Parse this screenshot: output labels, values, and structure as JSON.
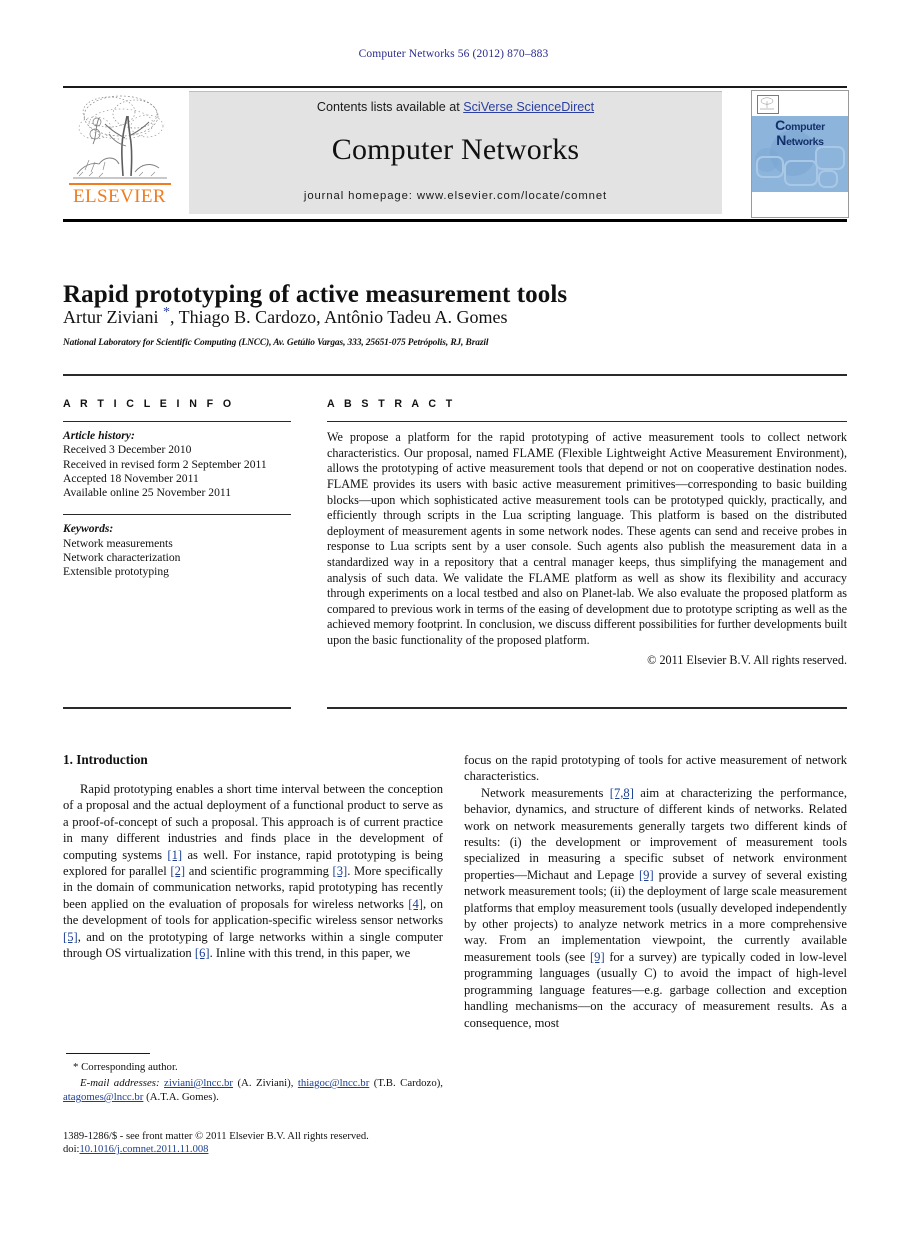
{
  "running_head": "Computer Networks 56 (2012) 870–883",
  "masthead": {
    "contents_prefix": "Contents lists available at ",
    "sciencedirect_link": "SciVerse ScienceDirect",
    "journal_title": "Computer Networks",
    "homepage": "journal homepage: www.elsevier.com/locate/comnet",
    "publisher_wordmark": "ELSEVIER",
    "cover_title_line1_big": "C",
    "cover_title_line1_rest": "omputer",
    "cover_title_line2_big": "N",
    "cover_title_line2_rest": "etworks"
  },
  "article": {
    "title": "Rapid prototyping of active measurement tools",
    "authors": "Artur Ziviani , Thiago B. Cardozo, Antônio Tadeu A. Gomes",
    "corresponding_marker": "*",
    "affiliation": "National Laboratory for Scientific Computing (LNCC), Av. Getúlio Vargas, 333, 25651-075 Petrópolis, RJ, Brazil"
  },
  "article_info": {
    "heading": "A R T I C L E   I N F O",
    "history_label": "Article history:",
    "history": [
      "Received 3 December 2010",
      "Received in revised form 2 September 2011",
      "Accepted 18 November 2011",
      "Available online 25 November 2011"
    ],
    "keywords_label": "Keywords:",
    "keywords": [
      "Network measurements",
      "Network characterization",
      "Extensible prototyping"
    ]
  },
  "abstract": {
    "heading": "A B S T R A C T",
    "text": "We propose a platform for the rapid prototyping of active measurement tools to collect network characteristics. Our proposal, named FLAME (Flexible Lightweight Active Measurement Environment), allows the prototyping of active measurement tools that depend or not on cooperative destination nodes. FLAME provides its users with basic active measurement primitives—corresponding to basic building blocks—upon which sophisticated active measurement tools can be prototyped quickly, practically, and efficiently through scripts in the Lua scripting language. This platform is based on the distributed deployment of measurement agents in some network nodes. These agents can send and receive probes in response to Lua scripts sent by a user console. Such agents also publish the measurement data in a standardized way in a repository that a central manager keeps, thus simplifying the management and analysis of such data. We validate the FLAME platform as well as show its flexibility and accuracy through experiments on a local testbed and also on Planet-lab. We also evaluate the proposed platform as compared to previous work in terms of the easing of development due to prototype scripting as well as the achieved memory footprint. In conclusion, we discuss different possibilities for further developments built upon the basic functionality of the proposed platform.",
    "copyright": "© 2011 Elsevier B.V. All rights reserved."
  },
  "body": {
    "section1_heading": "1. Introduction",
    "left_para1_a": "Rapid prototyping enables a short time interval between the conception of a proposal and the actual deployment of a functional product to serve as a proof-of-concept of such a proposal. This approach is of current practice in many different industries and finds place in the development of computing systems ",
    "left_ref1": "[1]",
    "left_para1_b": " as well. For instance, rapid prototyping is being explored for parallel ",
    "left_ref2": "[2]",
    "left_para1_c": " and scientific programming ",
    "left_ref3": "[3]",
    "left_para1_d": ". More specifically in the domain of communication networks, rapid prototyping has recently been applied on the evaluation of proposals for wireless networks ",
    "left_ref4": "[4]",
    "left_para1_e": ", on the development of tools for application-specific wireless sensor networks ",
    "left_ref5": "[5]",
    "left_para1_f": ", and on the prototyping of large networks within a single computer through OS virtualization ",
    "left_ref6": "[6]",
    "left_para1_g": ". Inline with this trend, in this paper, we",
    "right_para1": "focus on the rapid prototyping of tools for active measurement of network characteristics.",
    "right_para2_a": "Network measurements ",
    "right_ref78": "[7,8]",
    "right_para2_b": " aim at characterizing the performance, behavior, dynamics, and structure of different kinds of networks. Related work on network measurements generally targets two different kinds of results: (i) the development or improvement of measurement tools specialized in measuring a specific subset of network environment properties—Michaut and Lepage ",
    "right_ref9": "[9]",
    "right_para2_c": " provide a survey of several existing network measurement tools; (ii) the deployment of large scale measurement platforms that employ measurement tools (usually developed independently by other projects) to analyze network metrics in a more comprehensive way. From an implementation viewpoint, the currently available measurement tools (see ",
    "right_ref9b": "[9]",
    "right_para2_d": " for a survey) are typically coded in low-level programming languages (usually C) to avoid the impact of high-level programming language features—e.g. garbage collection and exception handling mechanisms—on the accuracy of measurement results. As a consequence, most"
  },
  "footnote": {
    "corresponding": "* Corresponding author.",
    "email_label": "E-mail addresses:",
    "email1": "ziviani@lncc.br",
    "email1_name": " (A. Ziviani), ",
    "email2": "thiagoc@lncc.br",
    "email2_name": " (T.B. Cardozo), ",
    "email3": "atagomes@lncc.br",
    "email3_name": " (A.T.A. Gomes)."
  },
  "imprint": {
    "issn_line": "1389-1286/$ - see front matter © 2011 Elsevier B.V. All rights reserved.",
    "doi_label": "doi:",
    "doi_value": "10.1016/j.comnet.2011.11.008"
  },
  "colors": {
    "link_blue": "#2b3fa0",
    "ref_blue": "#1c3f94",
    "elsevier_orange": "#f07c1f",
    "band_grey": "#e3e3e3",
    "cover_blue": "#8db4da"
  }
}
